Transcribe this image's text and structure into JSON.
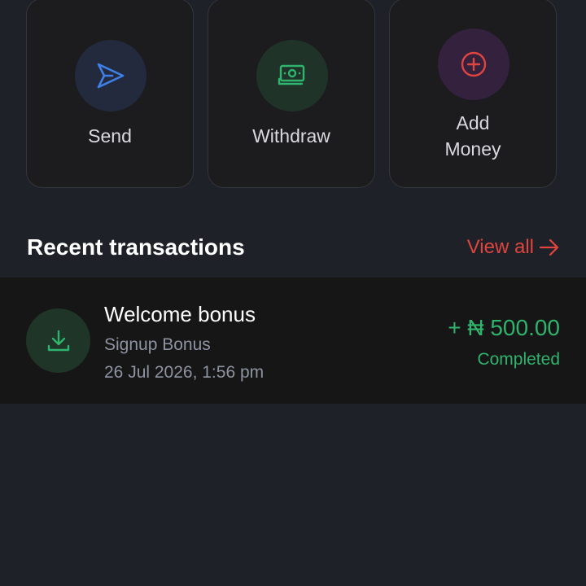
{
  "actions": [
    {
      "label": "Send",
      "icon": "send-icon",
      "color": "#3f7fe8"
    },
    {
      "label": "Withdraw",
      "icon": "cash-icon",
      "color": "#2fb36d"
    },
    {
      "label_line1": "Add",
      "label_line2": "Money",
      "icon": "plus-circle-icon",
      "color": "#e0443e"
    }
  ],
  "recent": {
    "title": "Recent transactions",
    "view_all_label": "View all",
    "view_all_icon": "arrow-right-icon"
  },
  "transactions": [
    {
      "title": "Welcome bonus",
      "subtitle": "Signup Bonus",
      "date": "26 Jul 2026, 1:56 pm",
      "amount": "+ ₦ 500.00",
      "status": "Completed",
      "icon": "download-icon"
    }
  ],
  "colors": {
    "background": "#1f2129",
    "card": "#1c1c1e",
    "accent_red": "#e0443e",
    "accent_green": "#2fb36d",
    "accent_blue": "#3f7fe8"
  }
}
